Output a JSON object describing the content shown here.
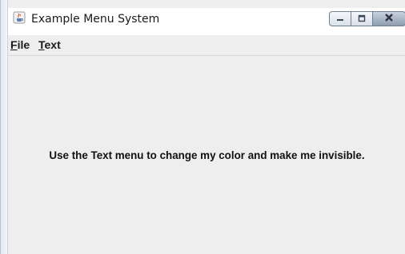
{
  "window": {
    "title": "Example Menu System",
    "app_icon": "java-cup-icon"
  },
  "menubar": {
    "items": [
      {
        "label_first": "F",
        "label_rest": "ile",
        "mnemonic": "F"
      },
      {
        "label_first": "T",
        "label_rest": "ext",
        "mnemonic": "T"
      }
    ]
  },
  "content": {
    "message": "Use the Text menu to change my color and make me invisible."
  },
  "caption_buttons": [
    "minimize-icon",
    "maximize-icon",
    "close-icon"
  ]
}
